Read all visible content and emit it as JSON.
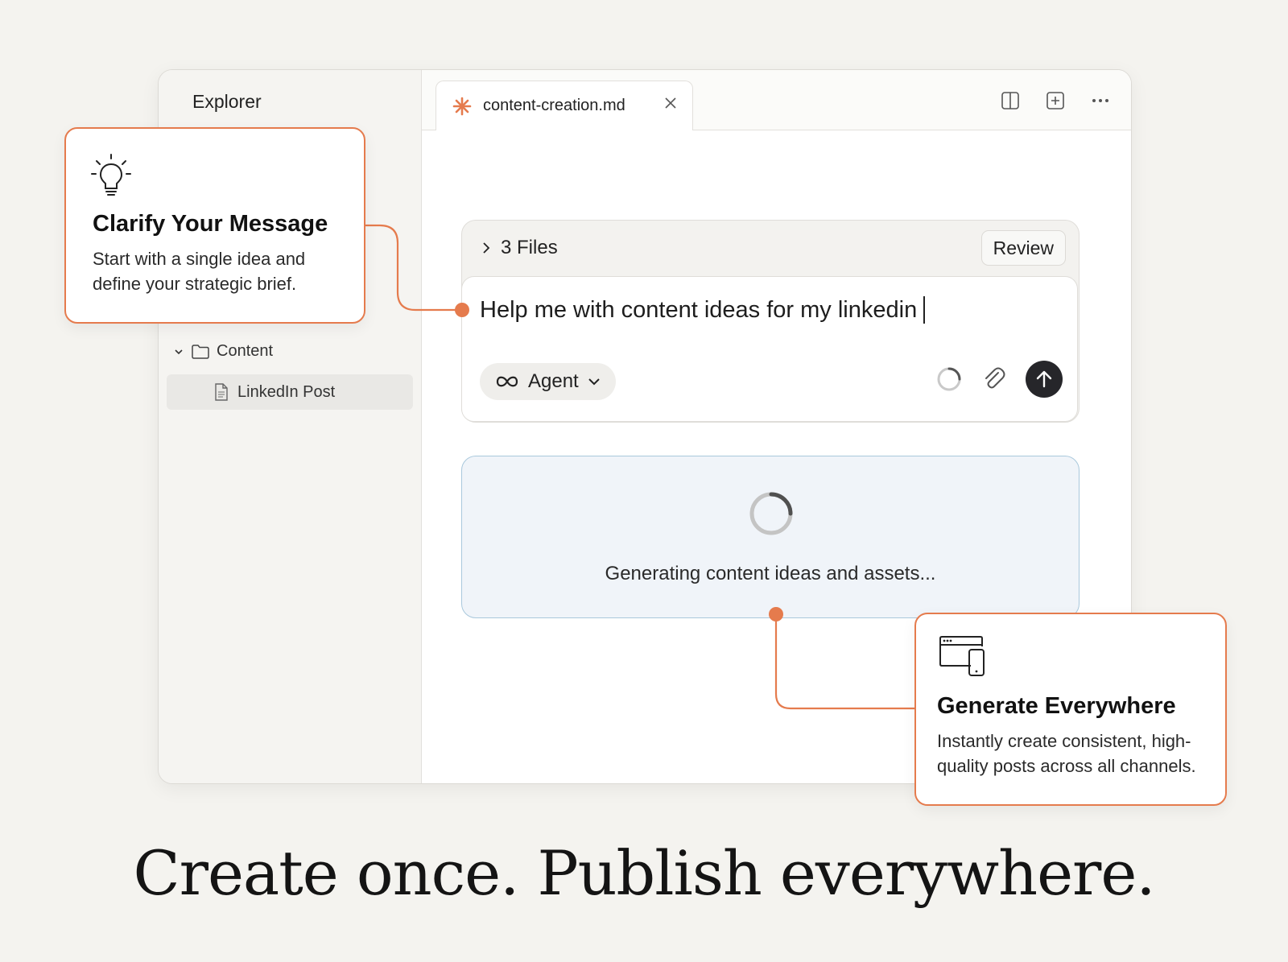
{
  "sidebar": {
    "title": "Explorer",
    "folder_label": "Content",
    "file_label": "LinkedIn Post"
  },
  "tab": {
    "filename": "content-creation.md"
  },
  "chat": {
    "files_label": "3 Files",
    "review_label": "Review",
    "input_text": "Help me with content ideas for my linkedin",
    "agent_label": "Agent"
  },
  "generating": {
    "status_text": "Generating content ideas and assets..."
  },
  "callouts": {
    "clarify": {
      "title": "Clarify Your Message",
      "body_line1": "Start with a single idea and",
      "body_line2": "define your strategic brief."
    },
    "generate": {
      "title": "Generate Everywhere",
      "body_line1": "Instantly create consistent, high-",
      "body_line2": "quality posts across all channels."
    }
  },
  "headline": "Create once. Publish everywhere.",
  "colors": {
    "accent": "#e57b4d",
    "background": "#f4f3ef",
    "panel_border": "#a9c8dc",
    "send_button": "#26262a"
  }
}
